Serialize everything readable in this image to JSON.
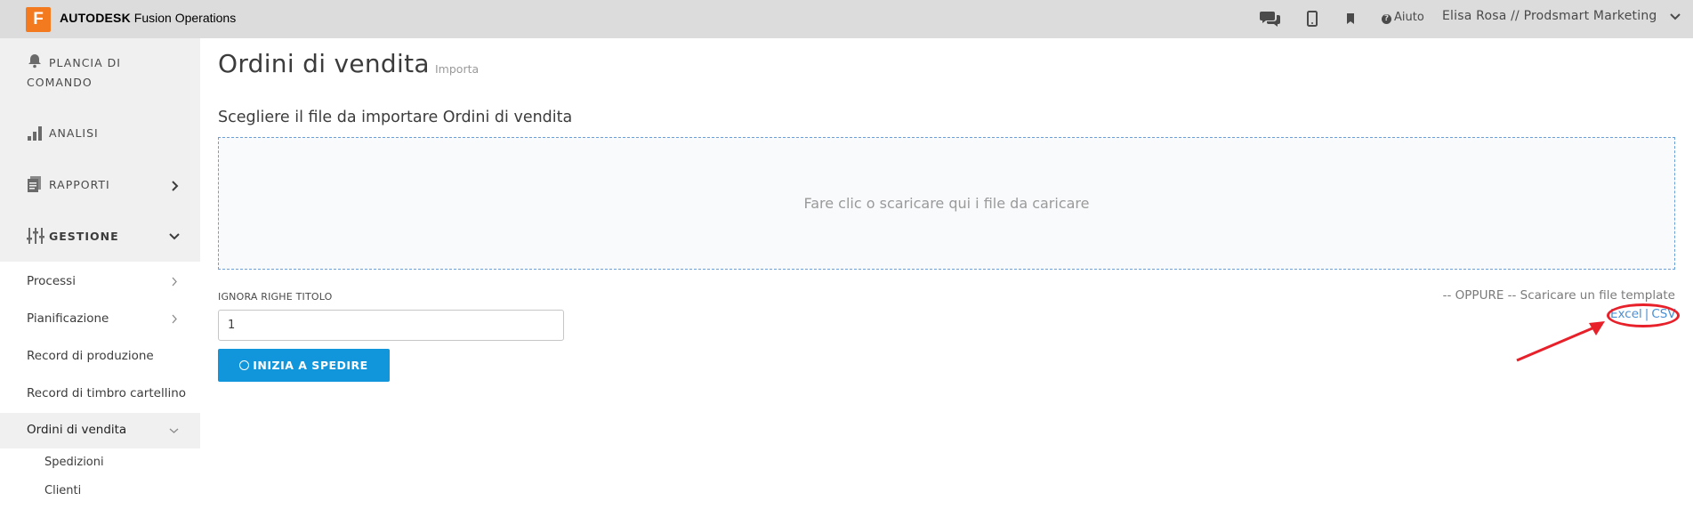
{
  "topbar": {
    "logo_letter": "F",
    "brand_bold": "AUTODESK",
    "brand_rest": "Fusion Operations",
    "icons": [
      "chat-icon",
      "mobile-icon",
      "bookmark-icon"
    ],
    "help_label": "Aiuto",
    "user_label": "Elisa Rosa // Prodsmart Marketing"
  },
  "sidebar": {
    "dashboard_line1": "PLANCIA DI",
    "dashboard_line2": "COMANDO",
    "analytics": "ANALISI",
    "reports": "RAPPORTI",
    "management": "GESTIONE",
    "items": [
      {
        "label": "Processi"
      },
      {
        "label": "Pianificazione"
      },
      {
        "label": "Record di produzione"
      },
      {
        "label": "Record di timbro cartellino"
      },
      {
        "label": "Ordini di vendita"
      }
    ],
    "subitems": [
      {
        "label": "Spedizioni"
      },
      {
        "label": "Clienti"
      }
    ]
  },
  "main": {
    "title": "Ordini di vendita",
    "subtitle": "Importa",
    "section_title": "Scegliere il file da importare Ordini di vendita",
    "dropzone_text": "Fare clic o scaricare qui i file da caricare",
    "skip_label": "IGNORA RIGHE TITOLO",
    "skip_value": "1",
    "start_button": "INIZIA A SPEDIRE",
    "or_text": "-- OPPURE -- Scaricare un file template",
    "link_excel": "Excel",
    "link_sep": "|",
    "link_csv": "CSV"
  },
  "colors": {
    "accent": "#1296db",
    "brand": "#f47a20",
    "highlight": "#e8202a",
    "link": "#4a8fd4"
  }
}
